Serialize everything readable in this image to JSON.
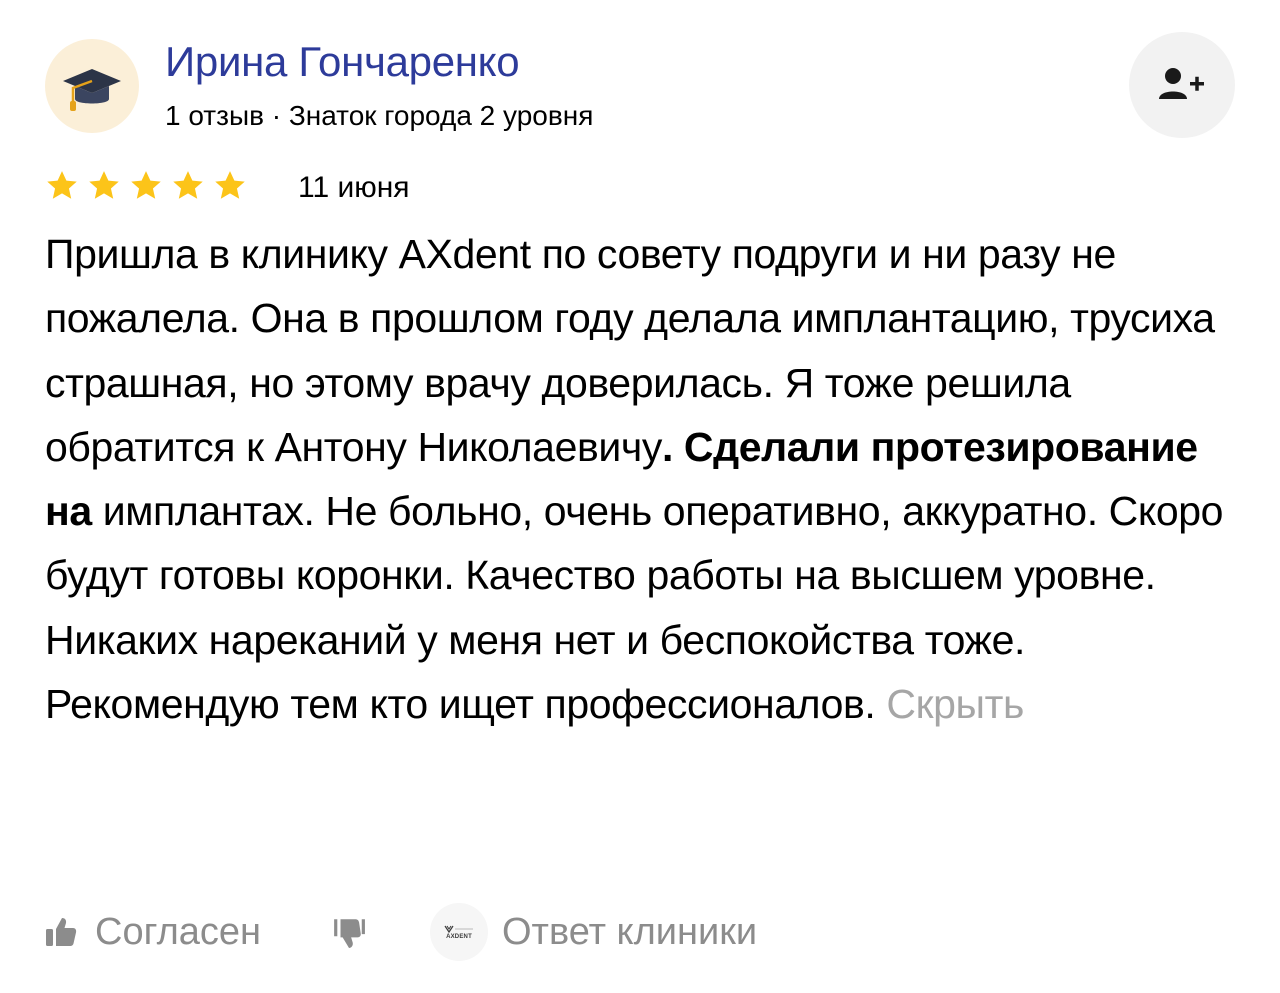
{
  "author": {
    "name": "Ирина Гончаренко",
    "meta": "1 отзыв · Знаток города 2 уровня",
    "avatar_icon": "graduation-cap-icon"
  },
  "follow_icon": "add-user-icon",
  "review": {
    "rating": 5,
    "rating_max": 5,
    "date": "11 июня",
    "text_part1": "Пришла в клинику AXdent по совету подруги и ни разу не пожалела. Она в прошлом году делала имплантацию, трусиха страшная, но этому врачу доверилась. Я тоже решила обратится к Антону Николаевичу",
    "text_bold": ". Сделали протезирование на",
    "text_part2": " имплантах. Не больно, очень оперативно, аккуратно. Скоро будут готовы коронки. Качество работы на высшем уровне. Никаких нареканий у меня нет и беспокойства тоже. Рекомендую тем кто ищет профессионалов.",
    "hide_label": "Скрыть"
  },
  "actions": {
    "like_label": "Согласен",
    "like_icon": "thumbs-up-icon",
    "dislike_icon": "thumbs-down-icon",
    "clinic_reply_label": "Ответ клиники",
    "clinic_logo_text": "AXDENT"
  },
  "colors": {
    "author_name": "#2d3b9a",
    "star": "#fcc419",
    "muted": "#8c8c8c",
    "hide_link": "#a6a6a6",
    "follow_bg": "#f2f2f2",
    "avatar_bg": "#fbefd8"
  }
}
